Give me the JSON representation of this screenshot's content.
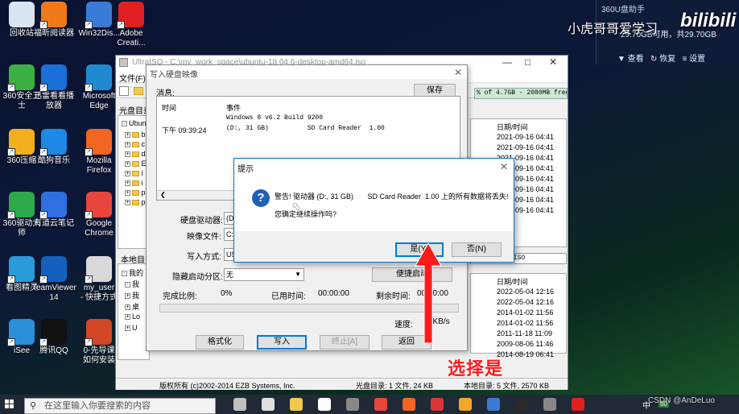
{
  "desktop_icons": [
    {
      "label": "回收站",
      "icon": "recycle-bin-icon",
      "color": "#d8e4f0"
    },
    {
      "label": "福昕阅读器",
      "icon": "foxit-reader-icon",
      "color": "#f07a1a"
    },
    {
      "label": "Win32Dis...",
      "icon": "win32diskimager-icon",
      "color": "#3a7bd5"
    },
    {
      "label": "Adobe\nCreati...",
      "icon": "adobe-creative-icon",
      "color": "#e02020"
    },
    {
      "label": "360安全卫士",
      "icon": "360-safe-icon",
      "color": "#3cb043"
    },
    {
      "label": "迅雷看看播放器",
      "icon": "xunlei-player-icon",
      "color": "#1a6fd8"
    },
    {
      "label": "Microsoft\nEdge",
      "icon": "edge-icon",
      "color": "#1f8ad2"
    },
    {
      "label": "360压缩",
      "icon": "360-zip-icon",
      "color": "#f2b01e"
    },
    {
      "label": "酷狗音乐",
      "icon": "kugou-icon",
      "color": "#1e88e5"
    },
    {
      "label": "Mozilla\nFirefox",
      "icon": "firefox-icon",
      "color": "#f26522"
    },
    {
      "label": "360驱动大师",
      "icon": "360-driver-icon",
      "color": "#2ea84a"
    },
    {
      "label": "有道云笔记",
      "icon": "youdao-note-icon",
      "color": "#2f6fe0"
    },
    {
      "label": "Google\nChrome",
      "icon": "chrome-icon",
      "color": "#e8453c"
    },
    {
      "label": "看图精灵",
      "icon": "image-viewer-icon",
      "color": "#2a9bd8"
    },
    {
      "label": "TeamViewer\n14",
      "icon": "teamviewer-icon",
      "color": "#1560bd"
    },
    {
      "label": "my_user\n- 快捷方式",
      "icon": "shortcut-file-icon",
      "color": "#d9d9d9"
    },
    {
      "label": "iSee",
      "icon": "isee-icon",
      "color": "#2a8fd8"
    },
    {
      "label": "腾讯QQ",
      "icon": "qq-icon",
      "color": "#111111"
    },
    {
      "label": "0-先导课\n如何安装",
      "icon": "ppt-file-icon",
      "color": "#d24726"
    }
  ],
  "overlay": {
    "app_title": "360U盘助手",
    "status_text": "29.70GB可用，共29.70GB",
    "buttons": [
      "▼ 查看",
      "↻ 恢复",
      "≡ 设置"
    ],
    "watermark": "小虎哥哥爱学习",
    "bili": "bilibili"
  },
  "main_window": {
    "title": "UltraISO - C:\\my_work_space\\ubuntu-18.04.6-desktop-amd64.iso",
    "menu_file": "文件(F)",
    "capacity": "% of 4.7GB - 2080MB free",
    "disc_dir_label": "光盘目录:",
    "tree_root": "Ubuntu",
    "tree_items": [
      "b",
      "c",
      "d",
      "E",
      "i",
      "i",
      "p",
      "p"
    ],
    "local_dir_label": "本地目录:",
    "local_tree": [
      "我的",
      "我",
      "我",
      "桌",
      "Lo",
      "U"
    ],
    "date_header": "日期/时间",
    "dates_top": [
      "2021-09-16 04:41",
      "2021-09-16 04:41",
      "2021-09-16 04:41",
      "2021-09-16 04:41",
      "2021-09-16 04:41",
      "2021-09-16 04:41",
      "2021-09-16 04:41",
      "2021-09-16 04:41"
    ],
    "local_path": "9\\App\\UltraISO",
    "dates_bottom": [
      "2022-05-04 12:16",
      "2022-05-04 12:16",
      "2014-01-02 11:56",
      "2014-01-02 11:56",
      "2011-11-18 11:09",
      "2009-08-06 11:46",
      "2014-08-19 06:41"
    ],
    "status_left": "版权所有 (c)2002-2014 EZB Systems, Inc.",
    "status_mid": "光盘目录: 1 文件, 24 KB",
    "status_right": "本地目录: 5 文件, 2570 KB"
  },
  "write_dialog": {
    "title": "写入硬盘映像",
    "message_label": "消息:",
    "save_button": "保存",
    "col_time": "时间",
    "col_event": "事件",
    "log": [
      {
        "time": "",
        "event": "Windows 8 v6.2 Build 9200"
      },
      {
        "time": "下午 09:39:24",
        "event": "(D:, 31 GB)          SD Card Reader  1.00"
      }
    ],
    "drive_label": "硬盘驱动器:",
    "drive_value": "(D:",
    "image_label": "映像文件:",
    "image_value": "C:",
    "method_label": "写入方式:",
    "method_value": "USB",
    "hidden_label": "隐藏启动分区:",
    "hidden_value": "无",
    "boot_button": "便捷启动",
    "done_label": "完成比例:",
    "done_value": "0%",
    "elapsed_label": "已用时间:",
    "elapsed_value": "00:00:00",
    "remaining_label": "剩余时间:",
    "remaining_value": "00:00:00",
    "speed_label": "速度:",
    "speed_value": "0KB/s",
    "progress": 0,
    "btn_format": "格式化",
    "btn_write": "写入",
    "btn_stop": "终止[A]",
    "btn_back": "返回"
  },
  "confirm_dialog": {
    "title": "提示",
    "warning": "警告! 驱动器 (D:, 31 GB)       SD Card Reader  1.00 上的所有数据将丢失!",
    "question": "您确定继续操作吗?",
    "yes": "是(Y)",
    "no": "否(N)"
  },
  "annotation": {
    "text": "选择是",
    "color": "#ff1a1a"
  },
  "taskbar": {
    "search_placeholder": "在这里输入你要搜索的内容",
    "tray_lang": "中",
    "tray_badge": "60",
    "csdn": "CSDN @AnDeLuo"
  }
}
